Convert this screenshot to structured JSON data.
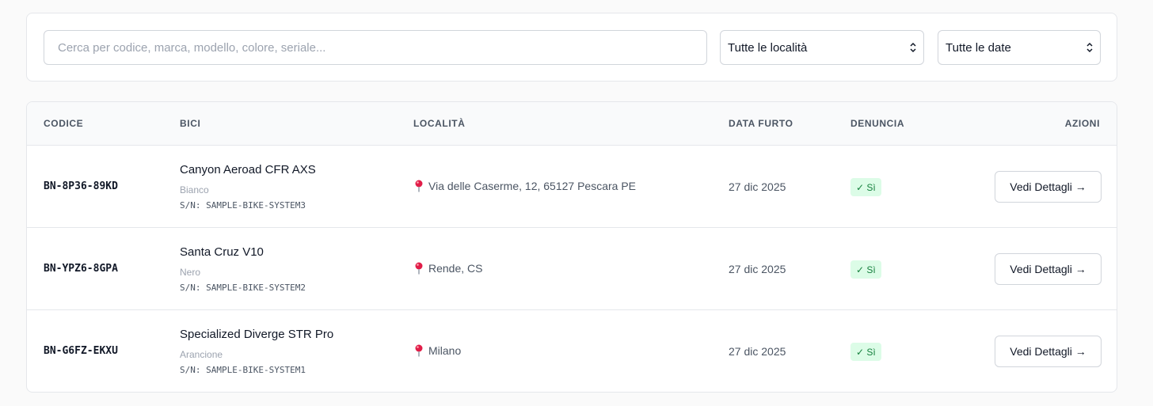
{
  "filters": {
    "search_placeholder": "Cerca per codice, marca, modello, colore, seriale...",
    "location_select": "Tutte le località",
    "date_select": "Tutte le date"
  },
  "table": {
    "headers": {
      "code": "CODICE",
      "bike": "BICI",
      "location": "LOCALITÀ",
      "theft_date": "DATA FURTO",
      "report": "DENUNCIA",
      "actions": "AZIONI"
    },
    "rows": [
      {
        "code": "BN-8P36-89KD",
        "name": "Canyon Aeroad CFR AXS",
        "color": "Bianco",
        "serial": "S/N: SAMPLE-BIKE-SYSTEM3",
        "location": "Via delle Caserme, 12, 65127 Pescara PE",
        "date": "27 dic 2025",
        "report": "✓ Sì",
        "action": "Vedi Dettagli →"
      },
      {
        "code": "BN-YPZ6-8GPA",
        "name": "Santa Cruz V10",
        "color": "Nero",
        "serial": "S/N: SAMPLE-BIKE-SYSTEM2",
        "location": "Rende, CS",
        "date": "27 dic 2025",
        "report": "✓ Sì",
        "action": "Vedi Dettagli →"
      },
      {
        "code": "BN-G6FZ-EKXU",
        "name": "Specialized Diverge STR Pro",
        "color": "Arancione",
        "serial": "S/N: SAMPLE-BIKE-SYSTEM1",
        "location": "Milano",
        "date": "27 dic 2025",
        "report": "✓ Sì",
        "action": "Vedi Dettagli →"
      }
    ]
  },
  "colors": {
    "badge_bg": "#dcfce7",
    "badge_text": "#15803d",
    "pin": "#e11d48"
  },
  "icons": {
    "location": "map-pin-icon",
    "select_arrows": "chevron-up-down-icon"
  }
}
